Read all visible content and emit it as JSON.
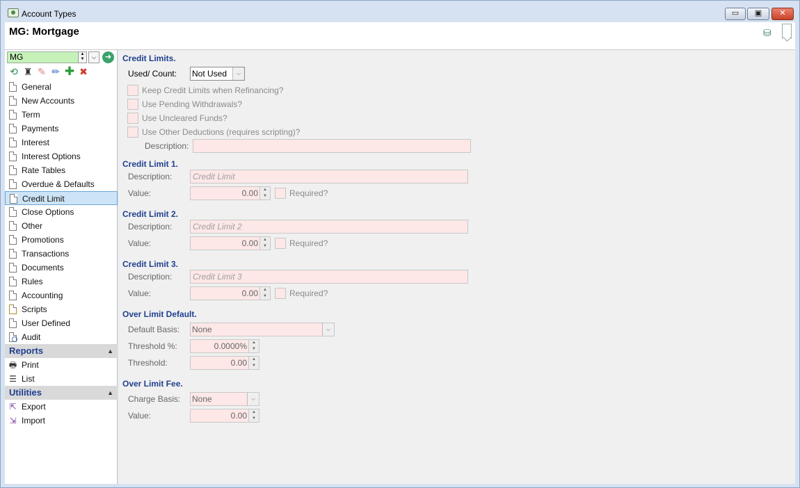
{
  "window": {
    "title": "Account Types",
    "min_label": "▭",
    "max_label": "▣",
    "close_label": "✕"
  },
  "header": {
    "record_title": "MG: Mortgage"
  },
  "sidebar": {
    "code_value": "MG",
    "nav": [
      "General",
      "New Accounts",
      "Term",
      "Payments",
      "Interest",
      "Interest Options",
      "Rate Tables",
      "Overdue & Defaults",
      "Credit Limit",
      "Close Options",
      "Other",
      "Promotions",
      "Transactions",
      "Documents",
      "Rules",
      "Accounting",
      "Scripts",
      "User Defined",
      "Audit"
    ],
    "active": "Credit Limit",
    "reports": {
      "title": "Reports",
      "items": [
        "Print",
        "List"
      ]
    },
    "utilities": {
      "title": "Utilities",
      "items": [
        "Export",
        "Import"
      ]
    }
  },
  "form": {
    "credit_limits": {
      "title": "Credit Limits.",
      "used_count_label": "Used/ Count:",
      "used_count_value": "Not Used",
      "keep_label": "Keep Credit Limits when Refinancing?",
      "pending_label": "Use Pending Withdrawals?",
      "uncleared_label": "Use Uncleared Funds?",
      "other_label": "Use Other Deductions (requires scripting)?",
      "description_label": "Description:",
      "description_value": ""
    },
    "limit1": {
      "title": "Credit Limit 1.",
      "description_label": "Description:",
      "description_placeholder": "Credit Limit",
      "value_label": "Value:",
      "value": "0.00",
      "required_label": "Required?"
    },
    "limit2": {
      "title": "Credit Limit 2.",
      "description_label": "Description:",
      "description_placeholder": "Credit Limit 2",
      "value_label": "Value:",
      "value": "0.00",
      "required_label": "Required?"
    },
    "limit3": {
      "title": "Credit Limit 3.",
      "description_label": "Description:",
      "description_placeholder": "Credit Limit 3",
      "value_label": "Value:",
      "value": "0.00",
      "required_label": "Required?"
    },
    "over_limit_default": {
      "title": "Over Limit Default.",
      "basis_label": "Default Basis:",
      "basis_value": "None",
      "threshold_pct_label": "Threshold %:",
      "threshold_pct_value": "0.0000%",
      "threshold_label": "Threshold:",
      "threshold_value": "0.00"
    },
    "over_limit_fee": {
      "title": "Over Limit Fee.",
      "charge_basis_label": "Charge Basis:",
      "charge_basis_value": "None",
      "value_label": "Value:",
      "value": "0.00"
    }
  }
}
